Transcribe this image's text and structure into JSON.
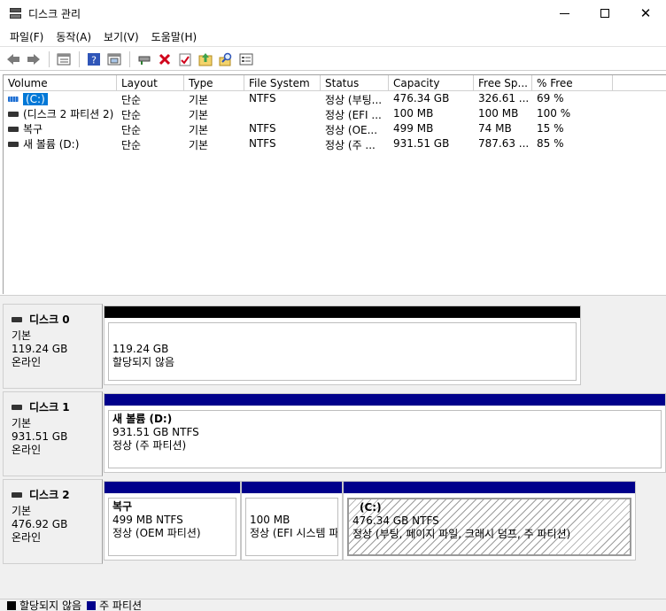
{
  "window": {
    "title": "디스크 관리"
  },
  "menu": [
    "파일(F)",
    "동작(A)",
    "보기(V)",
    "도움말(H)"
  ],
  "toolbar": [
    "back-arrow-icon",
    "forward-arrow-icon",
    "disk-list-icon",
    "help-icon",
    "properties-icon",
    "connect-drive-icon",
    "delete-icon",
    "check-icon",
    "import-icon",
    "search-icon",
    "settings-icon"
  ],
  "volume_list": {
    "columns": [
      "Volume",
      "Layout",
      "Type",
      "File System",
      "Status",
      "Capacity",
      "Free Sp...",
      "% Free"
    ],
    "rows": [
      {
        "volume": "(C:)",
        "layout": "단순",
        "type": "기본",
        "fs": "NTFS",
        "status": "정상 (부팅...",
        "capacity": "476.34 GB",
        "free": "326.61 ...",
        "pct": "69 %"
      },
      {
        "volume": "(디스크 2 파티션 2)",
        "layout": "단순",
        "type": "기본",
        "fs": "",
        "status": "정상 (EFI ...",
        "capacity": "100 MB",
        "free": "100 MB",
        "pct": "100 %"
      },
      {
        "volume": "복구",
        "layout": "단순",
        "type": "기본",
        "fs": "NTFS",
        "status": "정상 (OE...",
        "capacity": "499 MB",
        "free": "74 MB",
        "pct": "15 %"
      },
      {
        "volume": "새 볼륨 (D:)",
        "layout": "단순",
        "type": "기본",
        "fs": "NTFS",
        "status": "정상 (주 ...",
        "capacity": "931.51 GB",
        "free": "787.63 ...",
        "pct": "85 %"
      }
    ]
  },
  "disks": [
    {
      "name": "디스크 0",
      "kind": "기본",
      "size": "119.24 GB",
      "state": "온라인",
      "partitions": [
        {
          "name": "",
          "line1": "119.24 GB",
          "line2": "할당되지 않음",
          "bar_color": "#000000"
        }
      ]
    },
    {
      "name": "디스크 1",
      "kind": "기본",
      "size": "931.51 GB",
      "state": "온라인",
      "partitions": [
        {
          "name": "새 볼륨  (D:)",
          "line1": "931.51 GB NTFS",
          "line2": "정상 (주 파티션)",
          "bar_color": "#00008b"
        }
      ]
    },
    {
      "name": "디스크 2",
      "kind": "기본",
      "size": "476.92 GB",
      "state": "온라인",
      "partitions": [
        {
          "name": "복구",
          "line1": "499 MB NTFS",
          "line2": "정상 (OEM 파티션)",
          "bar_color": "#00008b"
        },
        {
          "name": "",
          "line1": "100 MB",
          "line2": "정상 (EFI 시스템 파",
          "bar_color": "#00008b"
        },
        {
          "name": "(C:)",
          "line1": "476.34 GB NTFS",
          "line2": "정상 (부팅, 페이지 파일, 크래시 덤프, 주 파티션)",
          "bar_color": "#00008b"
        }
      ]
    }
  ],
  "legend": [
    {
      "label": "할당되지 않음",
      "color": "#000000"
    },
    {
      "label": "주 파티션",
      "color": "#00008b"
    }
  ]
}
